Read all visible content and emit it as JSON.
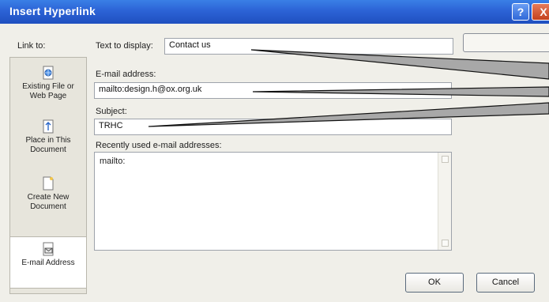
{
  "dialog": {
    "title": "Insert Hyperlink",
    "help_glyph": "?",
    "close_glyph": "X"
  },
  "link_to": {
    "label": "Link to:",
    "items": [
      {
        "line1": "Existing File or",
        "line2": "Web Page",
        "icon": "web-page-icon",
        "selected": false
      },
      {
        "line1": "Place in This",
        "line2": "Document",
        "icon": "place-in-document-icon",
        "selected": false
      },
      {
        "line1": "Create New",
        "line2": "Document",
        "icon": "new-document-icon",
        "selected": false
      },
      {
        "line1": "E-mail Address",
        "line2": "",
        "icon": "email-address-icon",
        "selected": true
      }
    ]
  },
  "text_to_display": {
    "label": "Text to display:",
    "value": "Contact us"
  },
  "email_address": {
    "label": "E-mail address:",
    "value": "mailto:design.h@ox.org.uk"
  },
  "subject": {
    "label": "Subject:",
    "value": "TRHC"
  },
  "recent": {
    "label": "Recently used e-mail addresses:",
    "items": [
      "mailto:"
    ]
  },
  "buttons": {
    "ok": "OK",
    "cancel": "Cancel"
  },
  "colors": {
    "titlebar": "#2c63d6",
    "callout": "#a8a8a8",
    "dialog_bg": "#f0efe9"
  }
}
